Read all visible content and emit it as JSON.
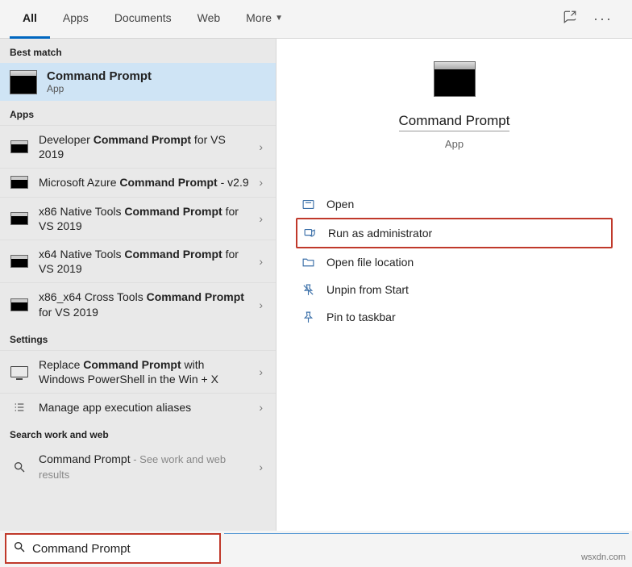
{
  "tabs": [
    "All",
    "Apps",
    "Documents",
    "Web",
    "More"
  ],
  "sections": {
    "best_match": "Best match",
    "apps": "Apps",
    "settings": "Settings",
    "web": "Search work and web"
  },
  "best_match": {
    "title": "Command Prompt",
    "subtitle": "App"
  },
  "apps": [
    {
      "pre": "Developer ",
      "bold": "Command Prompt",
      "post": " for VS 2019"
    },
    {
      "pre": "Microsoft Azure ",
      "bold": "Command Prompt",
      "post": " - v2.9"
    },
    {
      "pre": "x86 Native Tools ",
      "bold": "Command Prompt",
      "post": " for VS 2019"
    },
    {
      "pre": "x64 Native Tools ",
      "bold": "Command Prompt",
      "post": " for VS 2019"
    },
    {
      "pre": "x86_x64 Cross Tools ",
      "bold": "Command Prompt",
      "post": " for VS 2019"
    }
  ],
  "settings": [
    {
      "pre": "Replace ",
      "bold": "Command Prompt",
      "post": " with Windows PowerShell in the Win + X"
    },
    {
      "pre": "Manage app execution aliases",
      "bold": "",
      "post": ""
    }
  ],
  "web": {
    "title": "Command Prompt",
    "hint": " - See work and web results"
  },
  "preview": {
    "title": "Command Prompt",
    "subtitle": "App"
  },
  "actions": {
    "open": "Open",
    "run_admin": "Run as administrator",
    "open_loc": "Open file location",
    "unpin": "Unpin from Start",
    "pin_taskbar": "Pin to taskbar"
  },
  "search": {
    "value": "Command Prompt"
  },
  "watermark": "wsxdn.com"
}
